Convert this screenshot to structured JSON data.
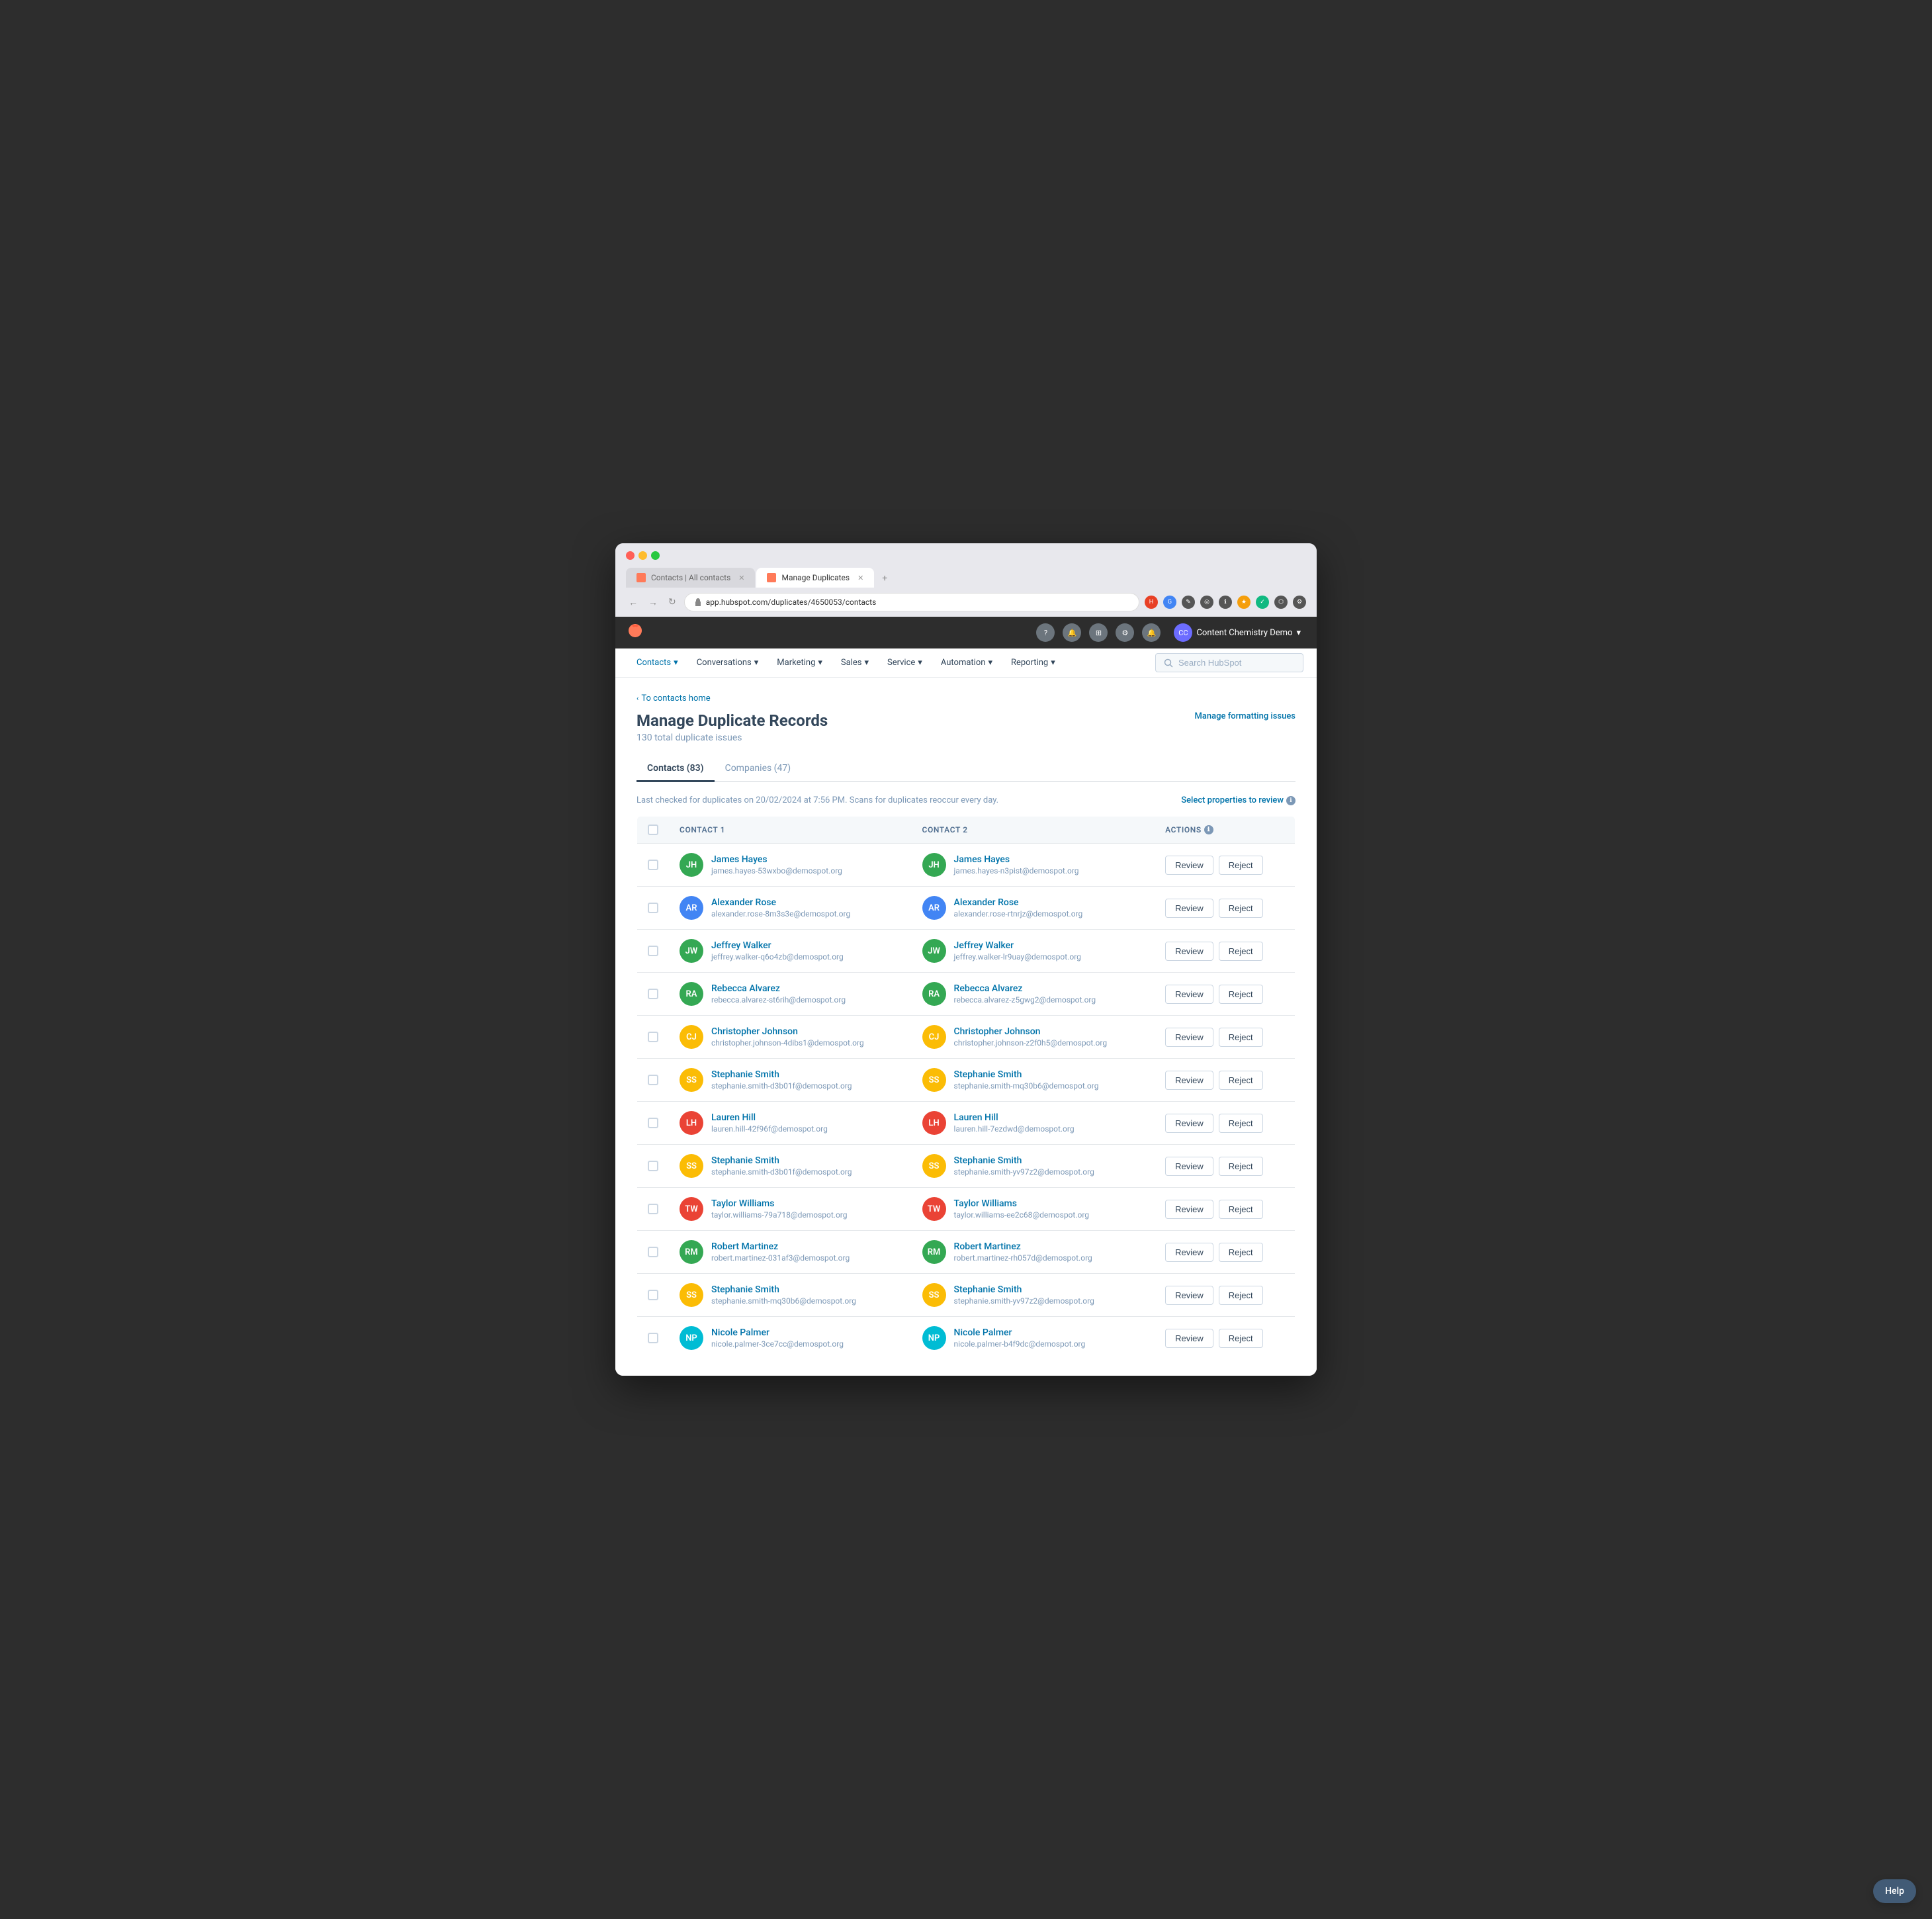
{
  "browser": {
    "url": "app.hubspot.com/duplicates/4650053/contacts",
    "tabs": [
      {
        "label": "Contacts | All contacts",
        "active": false,
        "favicon": "hs"
      },
      {
        "label": "Manage Duplicates",
        "active": true,
        "favicon": "hs"
      }
    ],
    "new_tab_icon": "+",
    "nav_back": "←",
    "nav_forward": "→",
    "nav_refresh": "↻"
  },
  "topnav": {
    "logo": "hs",
    "account_name": "Content Chemistry Demo",
    "account_chevron": "▾"
  },
  "mainnav": {
    "items": [
      {
        "label": "Contacts",
        "has_chevron": true
      },
      {
        "label": "Conversations",
        "has_chevron": true
      },
      {
        "label": "Marketing",
        "has_chevron": true
      },
      {
        "label": "Sales",
        "has_chevron": true
      },
      {
        "label": "Service",
        "has_chevron": true
      },
      {
        "label": "Automation",
        "has_chevron": true
      },
      {
        "label": "Reporting",
        "has_chevron": true
      }
    ],
    "search_placeholder": "Search HubSpot"
  },
  "page": {
    "breadcrumb": "To contacts home",
    "title": "Manage Duplicate Records",
    "subtitle": "130 total duplicate issues",
    "manage_formatting": "Manage formatting issues",
    "tabs": [
      {
        "label": "Contacts (83)",
        "active": true
      },
      {
        "label": "Companies (47)",
        "active": false
      }
    ],
    "info_text": "Last checked for duplicates on 20/02/2024 at 7:56 PM. Scans for duplicates reoccur every day.",
    "select_props": "Select properties to review",
    "table": {
      "headers": [
        "",
        "CONTACT 1",
        "CONTACT 2",
        "ACTIONS"
      ],
      "rows": [
        {
          "contact1_name": "James Hayes",
          "contact1_email": "james.hayes-53wxbo@demospot.org",
          "contact2_name": "James Hayes",
          "contact2_email": "james.hayes-n3pist@demospot.org"
        },
        {
          "contact1_name": "Alexander Rose",
          "contact1_email": "alexander.rose-8m3s3e@demospot.org",
          "contact2_name": "Alexander Rose",
          "contact2_email": "alexander.rose-rtnrjz@demospot.org"
        },
        {
          "contact1_name": "Jeffrey Walker",
          "contact1_email": "jeffrey.walker-q6o4zb@demospot.org",
          "contact2_name": "Jeffrey Walker",
          "contact2_email": "jeffrey.walker-lr9uay@demospot.org"
        },
        {
          "contact1_name": "Rebecca Alvarez",
          "contact1_email": "rebecca.alvarez-st6rih@demospot.org",
          "contact2_name": "Rebecca Alvarez",
          "contact2_email": "rebecca.alvarez-z5gwg2@demospot.org"
        },
        {
          "contact1_name": "Christopher Johnson",
          "contact1_email": "christopher.johnson-4dibs1@demospot.org",
          "contact2_name": "Christopher Johnson",
          "contact2_email": "christopher.johnson-z2f0h5@demospot.org"
        },
        {
          "contact1_name": "Stephanie Smith",
          "contact1_email": "stephanie.smith-d3b01f@demospot.org",
          "contact2_name": "Stephanie Smith",
          "contact2_email": "stephanie.smith-mq30b6@demospot.org"
        },
        {
          "contact1_name": "Lauren Hill",
          "contact1_email": "lauren.hill-42f96f@demospot.org",
          "contact2_name": "Lauren Hill",
          "contact2_email": "lauren.hill-7ezdwd@demospot.org"
        },
        {
          "contact1_name": "Stephanie Smith",
          "contact1_email": "stephanie.smith-d3b01f@demospot.org",
          "contact2_name": "Stephanie Smith",
          "contact2_email": "stephanie.smith-yv97z2@demospot.org"
        },
        {
          "contact1_name": "Taylor Williams",
          "contact1_email": "taylor.williams-79a718@demospot.org",
          "contact2_name": "Taylor Williams",
          "contact2_email": "taylor.williams-ee2c68@demospot.org"
        },
        {
          "contact1_name": "Robert Martinez",
          "contact1_email": "robert.martinez-031af3@demospot.org",
          "contact2_name": "Robert Martinez",
          "contact2_email": "robert.martinez-rh057d@demospot.org"
        },
        {
          "contact1_name": "Stephanie Smith",
          "contact1_email": "stephanie.smith-mq30b6@demospot.org",
          "contact2_name": "Stephanie Smith",
          "contact2_email": "stephanie.smith-yv97z2@demospot.org"
        },
        {
          "contact1_name": "Nicole Palmer",
          "contact1_email": "nicole.palmer-3ce7cc@demospot.org",
          "contact2_name": "Nicole Palmer",
          "contact2_email": "nicole.palmer-b4f9dc@demospot.org"
        }
      ],
      "btn_review": "Review",
      "btn_reject": "Reject"
    }
  },
  "help_btn": "Help"
}
